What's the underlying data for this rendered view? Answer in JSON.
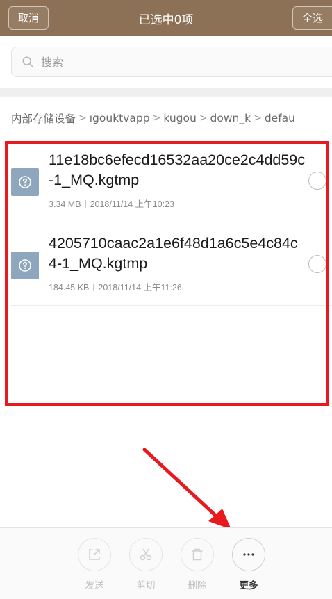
{
  "header": {
    "cancel_label": "取消",
    "title": "已选中0项",
    "select_all_label": "全选",
    "bg_color": "#8c7156"
  },
  "search": {
    "placeholder": "搜索"
  },
  "breadcrumb": {
    "items": [
      "内部存储设备",
      "ıgouktvapp",
      "kugou",
      "down_k",
      "defau"
    ]
  },
  "files": [
    {
      "name": "11e18bc6efecd16532aa20ce2c4dd59c-1_MQ.kgtmp",
      "size": "3.34 MB",
      "date": "2018/11/14 上午10:23",
      "icon": "unknown-file-icon",
      "selected": false
    },
    {
      "name": "4205710caac2a1e6f48d1a6c5e4c84c4-1_MQ.kgtmp",
      "size": "184.45 KB",
      "date": "2018/11/14 上午11:26",
      "icon": "unknown-file-icon",
      "selected": false
    }
  ],
  "toolbar": {
    "items": [
      {
        "label": "发送",
        "icon": "share-icon",
        "enabled": false
      },
      {
        "label": "剪切",
        "icon": "scissors-icon",
        "enabled": false
      },
      {
        "label": "删除",
        "icon": "trash-icon",
        "enabled": false
      },
      {
        "label": "更多",
        "icon": "more-icon",
        "enabled": true
      }
    ]
  },
  "annotation": {
    "highlight_color": "#e8191f"
  }
}
